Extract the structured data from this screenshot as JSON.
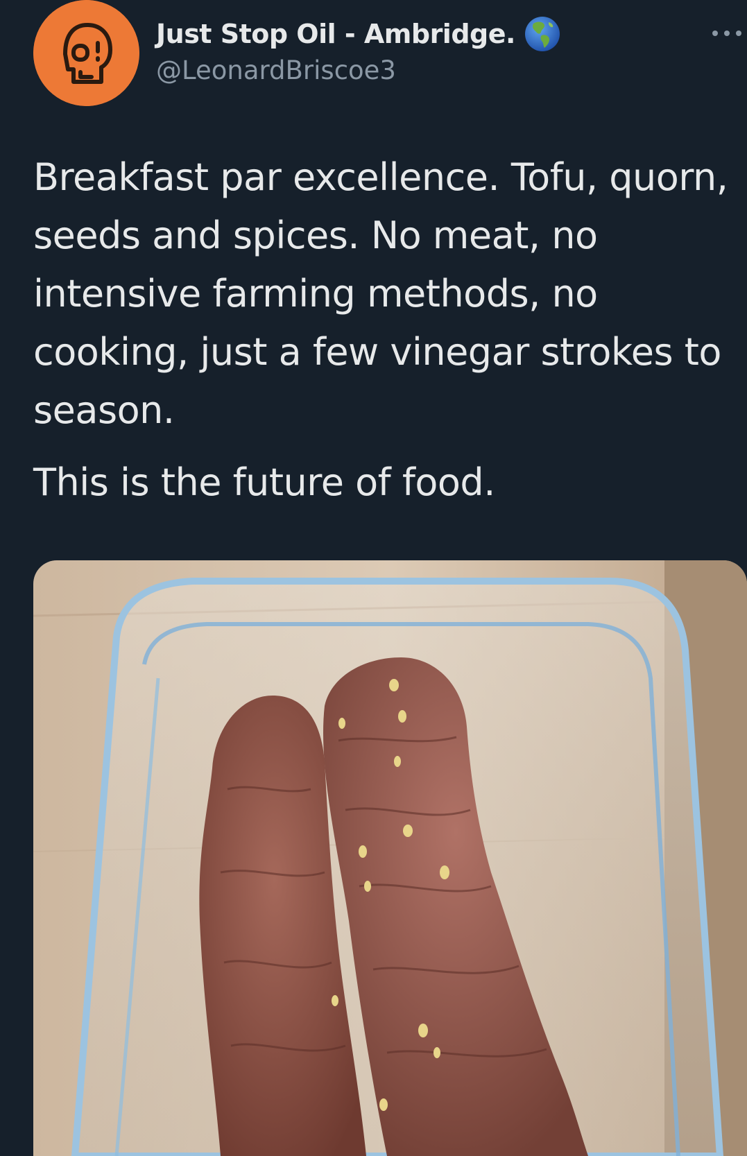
{
  "tweet": {
    "author": {
      "display_name": "Just Stop Oil - Ambridge.",
      "handle": "@LeonardBriscoe3",
      "verified_badge_icon": "globe-earth-americas-icon",
      "avatar_icon": "skull-icon"
    },
    "text": {
      "paragraph_1": "Breakfast par excellence. Tofu, quorn, seeds and spices. No meat, no intensive farming methods, no cooking, just a few vinegar strokes to season.",
      "paragraph_2": "This is the future of food."
    },
    "more_menu_icon": "ellipsis-icon",
    "media": {
      "type": "photo",
      "description_icon": "photo-icon"
    }
  },
  "colors": {
    "background": "#16202b",
    "primary_text": "#e7e9ea",
    "secondary_text": "#8b98a5",
    "avatar_bg": "#ed7936"
  }
}
